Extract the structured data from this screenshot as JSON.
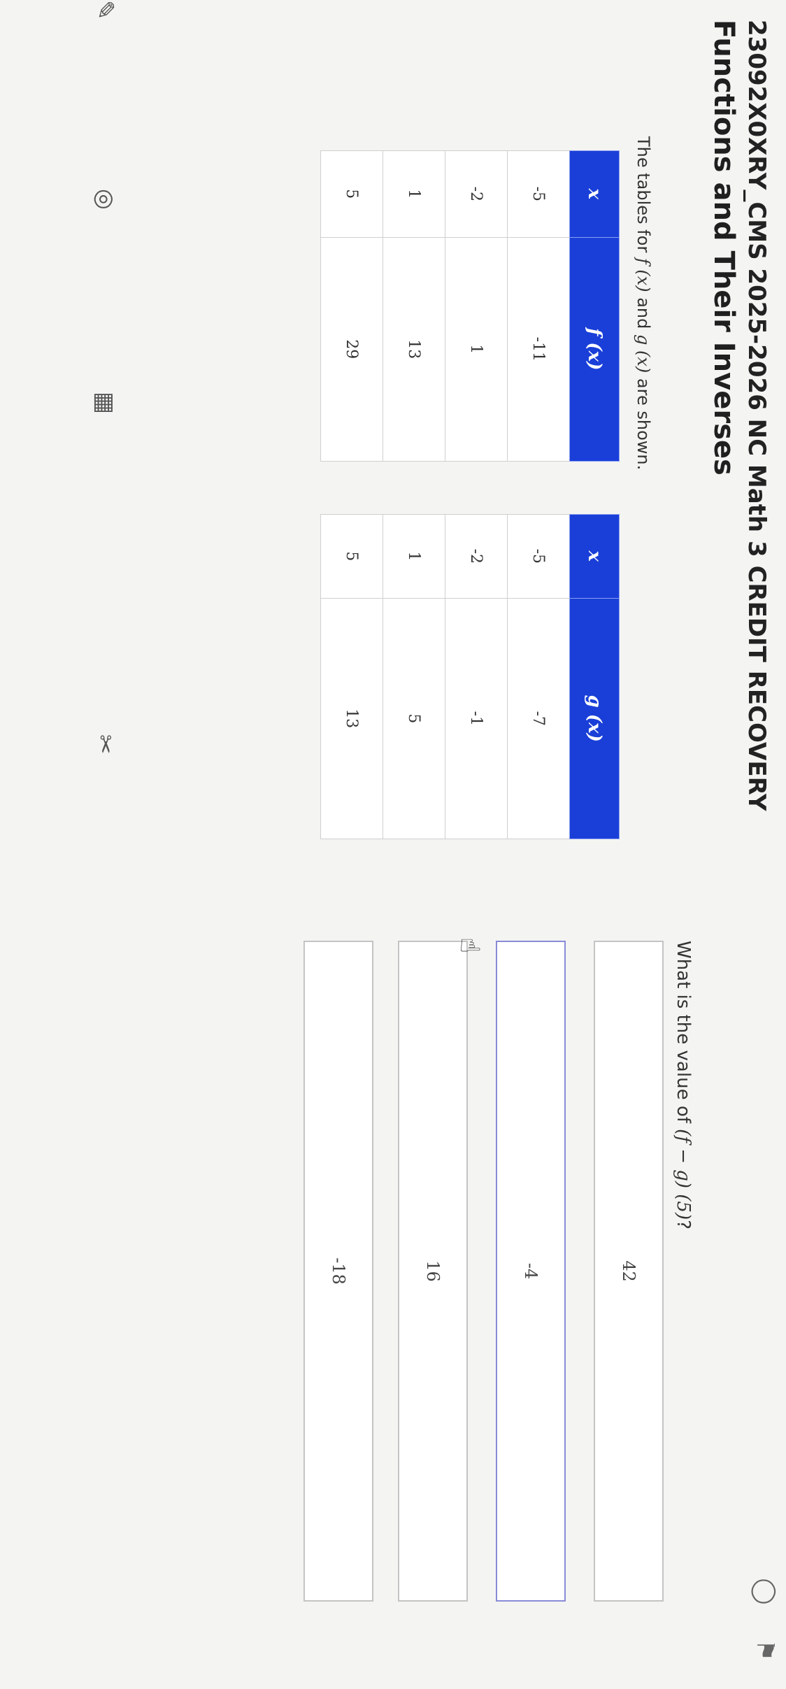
{
  "header": {
    "course_title": "23092X0XRY_CMS 2025-2026 NC Math 3 CREDIT RECOVERY",
    "lesson_title": "Functions and Their Inverses",
    "icons": [
      "lightbulb-icon",
      "flag-icon"
    ]
  },
  "content": {
    "intro_prefix": "The tables for ",
    "intro_f": "f (x)",
    "intro_mid": " and ",
    "intro_g": "g (x)",
    "intro_suffix": " are shown.",
    "table_f": {
      "headers": [
        "x",
        "f (x)"
      ],
      "rows": [
        [
          "-5",
          "-11"
        ],
        [
          "-2",
          "1"
        ],
        [
          "1",
          "13"
        ],
        [
          "5",
          "29"
        ]
      ]
    },
    "table_g": {
      "headers": [
        "x",
        "g (x)"
      ],
      "rows": [
        [
          "-5",
          "-7"
        ],
        [
          "-2",
          "-1"
        ],
        [
          "1",
          "5"
        ],
        [
          "5",
          "13"
        ]
      ]
    }
  },
  "question": {
    "prefix": "What is the value of ",
    "expression": "(f − g) (5)",
    "suffix": "?",
    "options": [
      "42",
      "-4",
      "16",
      "-18"
    ]
  },
  "tools": [
    "pencil-icon",
    "globe-icon",
    "calculator-icon",
    "scissors-icon"
  ]
}
